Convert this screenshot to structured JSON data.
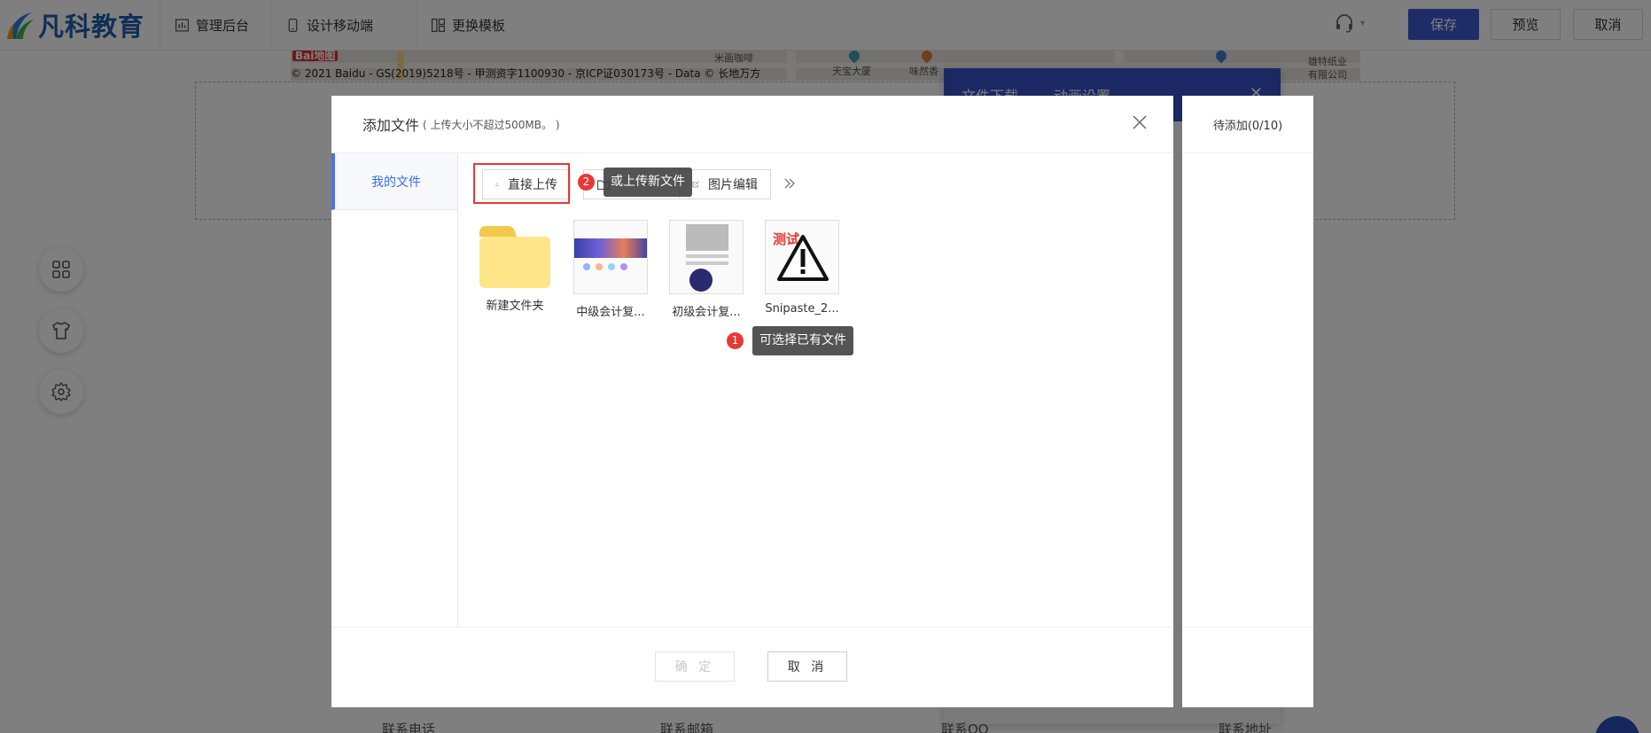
{
  "header": {
    "logo_text": "凡科教育",
    "nav": [
      {
        "label": "管理后台",
        "icon": "bar-chart-icon"
      },
      {
        "label": "设计移动端",
        "icon": "mobile-icon"
      },
      {
        "label": "更换模板",
        "icon": "template-icon"
      }
    ],
    "support_icon": "headset-icon",
    "buttons": {
      "save": "保存",
      "preview": "预览",
      "cancel": "取消"
    }
  },
  "background": {
    "map": {
      "copyright": "© 2021 Baidu - GS(2019)5218号 - 甲测资字1100930 - 京ICP证030173号 - Data © 长地万方",
      "labels": [
        "米画咖啡",
        "天宝大厦",
        "味然香",
        "雄特纸业",
        "有限公司"
      ],
      "baidu_badge": "Bai地图"
    },
    "panel_tabs": [
      "文件下载",
      "动画设置"
    ],
    "footer_labels": [
      "联系电话",
      "联系邮箱",
      "联系QQ",
      "联系地址"
    ],
    "left_tools": [
      "apps-icon",
      "shirt-icon",
      "settings-icon"
    ]
  },
  "modal": {
    "title": "添加文件",
    "hint": "( 上传大小不超过500MB。 )",
    "sidebar": {
      "items": [
        {
          "label": "我的文件",
          "active": true
        }
      ]
    },
    "toolbar": {
      "upload": "直接上传",
      "new_folder": "",
      "edit_image": "图片编辑"
    },
    "files": [
      {
        "name": "新建文件夹",
        "type": "folder"
      },
      {
        "name": "中级会计复...",
        "type": "image"
      },
      {
        "name": "初级会计复...",
        "type": "image"
      },
      {
        "name": "Snipaste_2...",
        "type": "image",
        "overlay_text": "测试"
      }
    ],
    "footer": {
      "ok": "确 定",
      "cancel": "取 消"
    },
    "queue_label": "待添加(0/10)"
  },
  "annotations": [
    {
      "number": "2",
      "text": "或上传新文件"
    },
    {
      "number": "1",
      "text": "可选择已有文件"
    }
  ],
  "colors": {
    "primary": "#3d5bd0",
    "accent_blue": "#3a6ee0",
    "highlight_red": "#e53935",
    "overlay": "rgba(0,0,0,0.5)"
  }
}
